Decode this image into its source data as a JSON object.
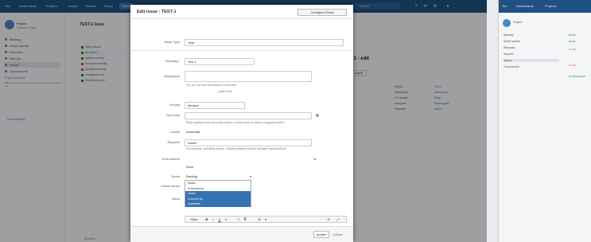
{
  "app": {
    "nav": [
      "Jira",
      "Dashboards",
      "Projects",
      "Issues",
      "Boards",
      "Tempo"
    ],
    "create_label": "Create",
    "search_placeholder": "Search",
    "project_title": "Project",
    "project_subtitle": "Software project",
    "sidebar_items": [
      "Backlog",
      "Active sprints",
      "Releases",
      "Reports",
      "Issues",
      "Components"
    ],
    "sidebar_section": "Project shortcuts",
    "sidebar_note": "Add a link to useful information for your whole team to see.",
    "feedback": "Give feedback",
    "issue_header": "TEST-1 Issue",
    "issue_title": "Test 1 - edit",
    "filters": [
      "Open issues",
      "All issues",
      "Added recently",
      "Resolved recently",
      "Updated recently",
      "Assigned to me",
      "Reported by me"
    ],
    "details": [
      {
        "k": "Status:",
        "v": "To Do"
      },
      {
        "k": "Resolution:",
        "v": "Unresolved"
      },
      {
        "k": "Fix Version:",
        "v": "None"
      },
      {
        "k": "Assignee:",
        "v": "Unassigned"
      },
      {
        "k": "Reporter:",
        "v": "Admin"
      }
    ],
    "export_label": "Export",
    "footer": "Atlassian"
  },
  "dialog": {
    "title": "Edit Issue : TEST-1",
    "configure_label": "Configure Fields",
    "issue_type_label": "Issue Type",
    "issue_type_value": "Task",
    "summary_label": "Summary",
    "summary_value": "Test 1",
    "description_label": "Description",
    "description_hint": "Tip: you can use wiki markup in this field.",
    "link_label": "Learn more",
    "priority_label": "Priority",
    "priority_value": "Medium",
    "due_label": "Due Date",
    "labels_label": "Labels",
    "labels_hint": "Begin typing to find and create labels or press down to select a suggested label.",
    "assignee_label": "Assignee",
    "assignee_value": "Automatic",
    "reporter_label": "Reporter",
    "reporter_value": "Admin",
    "env_label": "Environment",
    "env_hint": "For example, operating system, software platform and/or hardware specifications.",
    "epic_label": "Epic Link",
    "epic_value": "None",
    "sprint_label": "Sprint",
    "sprint_value": "Backlog",
    "linked_label": "Linked Issues",
    "linked_value": "blocks",
    "issue_label": "Issue",
    "listbox_options": [
      "blocks",
      "is blocked by",
      "clones",
      "is cloned by",
      "duplicates"
    ],
    "listbox_selected": [
      2,
      3,
      4
    ],
    "comment_label": "Comment",
    "toolbar": [
      "Style",
      "B",
      "I",
      "U",
      "A",
      "≡",
      "≣",
      "⊕",
      "▾",
      "⟲",
      "⤢"
    ],
    "update_label": "Update",
    "cancel_label": "Cancel"
  },
  "win2": {
    "nav": [
      "Jira",
      "Dashboards",
      "Projects"
    ],
    "lines": [
      "Project",
      "Backlog",
      "Active sprints",
      "Releases",
      "Reports",
      "Issues",
      "Components"
    ],
    "tags": [
      "DONE",
      "DONE",
      "TO DO",
      "TO DO",
      "IN PROGRESS"
    ]
  }
}
